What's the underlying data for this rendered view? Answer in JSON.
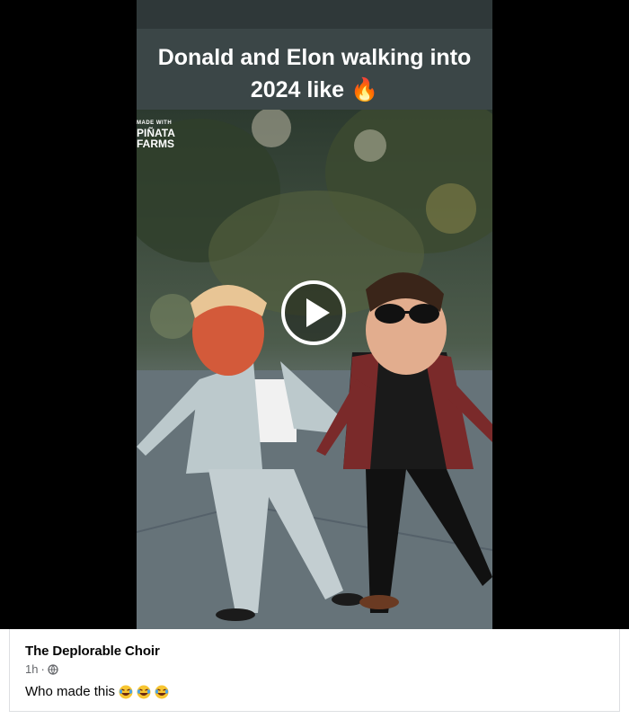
{
  "video": {
    "caption": "Donald and Elon walking into 2024 like 🔥",
    "watermark_line1": "MADE WITH",
    "watermark_line2": "PIÑATA",
    "watermark_line3": "FARMS",
    "play_icon": "play-icon"
  },
  "post": {
    "author": "The Deplorable Choir",
    "time": "1h",
    "separator": "·",
    "audience_icon": "globe-icon",
    "text": "Who made this",
    "emojis": [
      "rolling-on-floor-laughing",
      "rolling-on-floor-laughing",
      "rolling-on-floor-laughing"
    ]
  },
  "colors": {
    "player_bg": "#000000",
    "caption_band": "#3b4647",
    "caption_text": "#ffffff",
    "author_text": "#050505",
    "meta_text": "#65676b"
  }
}
